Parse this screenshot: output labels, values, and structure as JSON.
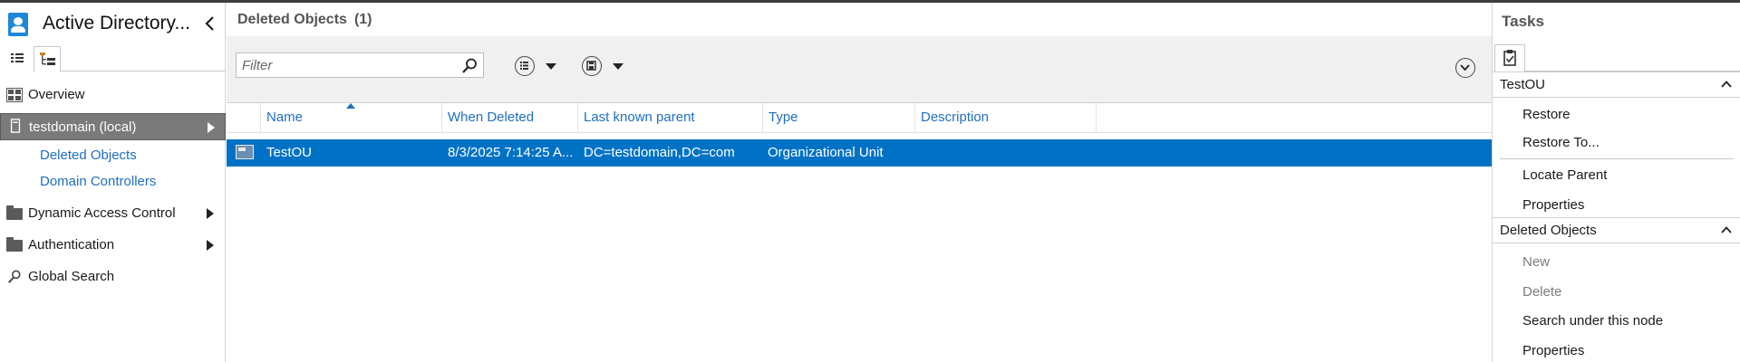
{
  "app": {
    "title": "Active Directory..."
  },
  "nav": {
    "items": [
      {
        "label": "Overview"
      },
      {
        "label": "testdomain (local)"
      },
      {
        "label": "Dynamic Access Control"
      },
      {
        "label": "Authentication"
      },
      {
        "label": "Global Search"
      }
    ],
    "subitems": [
      {
        "label": "Deleted Objects"
      },
      {
        "label": "Domain Controllers"
      }
    ]
  },
  "main": {
    "title": "Deleted Objects",
    "count": "(1)",
    "filter_placeholder": "Filter",
    "columns": [
      "Name",
      "When Deleted",
      "Last known parent",
      "Type",
      "Description"
    ],
    "rows": [
      {
        "name": "TestOU",
        "when_deleted": "8/3/2025 7:14:25 A...",
        "last_known_parent": "DC=testdomain,DC=com",
        "type": "Organizational Unit",
        "description": ""
      }
    ]
  },
  "tasks": {
    "title": "Tasks",
    "sections": [
      {
        "title": "TestOU",
        "items": [
          "Restore",
          "Restore To...",
          "Locate Parent",
          "Properties"
        ]
      },
      {
        "title": "Deleted Objects",
        "items": [
          "New",
          "Delete",
          "Search under this node",
          "Properties"
        ]
      }
    ]
  },
  "colors": {
    "selection": "#0072c6",
    "link": "#1f6fc0",
    "nav_selected": "#7a7a7a",
    "app_icon": "#1e88d6"
  }
}
